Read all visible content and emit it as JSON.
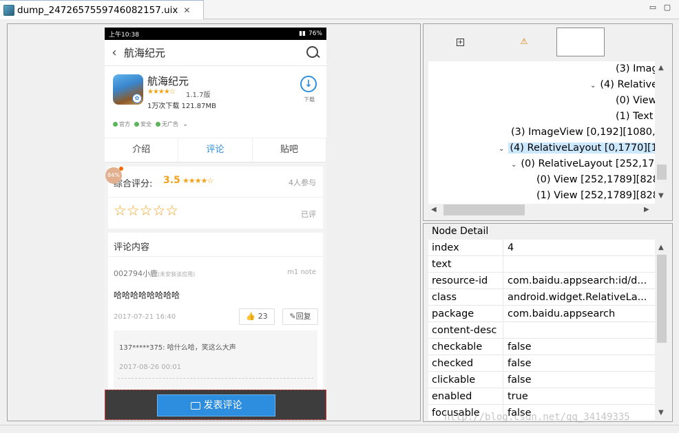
{
  "window": {
    "tab_title": "dump_2472657559746082157.uix",
    "tab_close": "✕",
    "minimize": "▭",
    "maximize": "▢"
  },
  "phone": {
    "status": {
      "time": "上午10:38",
      "battery": "76%"
    },
    "title": "航海纪元",
    "app": {
      "name": "航海纪元",
      "stars": "★★★★☆",
      "version": "1.1.7版",
      "downloads": "1万次下载  121.87MB",
      "download_label": "下载",
      "tags": [
        "官方",
        "安全",
        "无广告"
      ]
    },
    "tabs": [
      "介绍",
      "评论",
      "贴吧"
    ],
    "rating": {
      "label": "综合评分:",
      "score": "3.5",
      "stars": "★★★★☆",
      "count": "4人参与",
      "empty_stars": "☆☆☆☆☆",
      "rated": "已评",
      "progress": "84%"
    },
    "comments": {
      "title": "评论内容",
      "user": "002794小鹿",
      "user_note": "(未安装该应用)",
      "device": "m1 note",
      "text": "哈哈哈哈哈哈哈哈",
      "date": "2017-07-21 16:40",
      "likes": "23",
      "reply_label": "回复",
      "reply": {
        "text": "137*****375:  哈什么哈，笑这么大声",
        "date": "2017-08-26 00:01"
      }
    },
    "post_button": "发表评论"
  },
  "tree": {
    "rows": [
      {
        "text": "(3) Imag",
        "chevron": ""
      },
      {
        "text": "(4) Relative",
        "chevron": "⌄"
      },
      {
        "text": "(0) View",
        "chevron": ""
      },
      {
        "text": "(1) Text",
        "chevron": ""
      },
      {
        "text": "(3) ImageView [0,192][1080,2",
        "chevron": ""
      },
      {
        "text": "(4) RelativeLayout [0,1770][10",
        "chevron": "⌄"
      },
      {
        "text": "(0) RelativeLayout [252,17",
        "chevron": "⌄"
      },
      {
        "text": "(0) View [252,1789][828",
        "chevron": ""
      },
      {
        "text": "(1) View [252,1789][828",
        "chevron": ""
      }
    ]
  },
  "detail": {
    "title": "Node Detail",
    "rows": [
      {
        "key": "index",
        "value": "4"
      },
      {
        "key": "text",
        "value": ""
      },
      {
        "key": "resource-id",
        "value": "com.baidu.appsearch:id/d..."
      },
      {
        "key": "class",
        "value": "android.widget.RelativeLa..."
      },
      {
        "key": "package",
        "value": "com.baidu.appsearch"
      },
      {
        "key": "content-desc",
        "value": ""
      },
      {
        "key": "checkable",
        "value": "false"
      },
      {
        "key": "checked",
        "value": "false"
      },
      {
        "key": "clickable",
        "value": "false"
      },
      {
        "key": "enabled",
        "value": "true"
      },
      {
        "key": "focusable",
        "value": "false"
      }
    ]
  },
  "watermark": "http://blog.csdn.net/qq_34149335"
}
